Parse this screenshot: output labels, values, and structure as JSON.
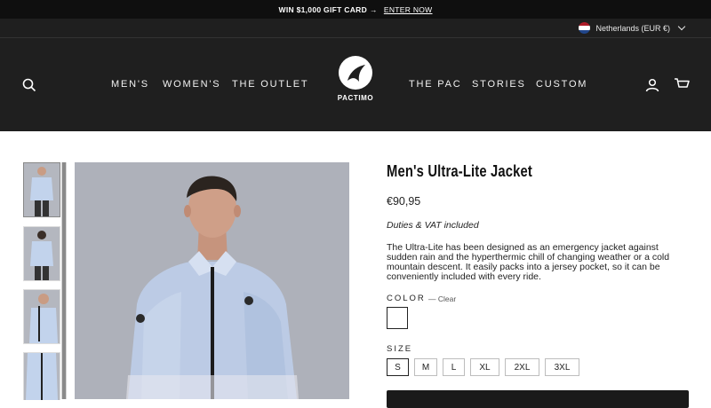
{
  "announcement": {
    "text": "WIN $1,000 GIFT CARD",
    "arrow": "→",
    "link": "ENTER NOW"
  },
  "locale": {
    "label": "Netherlands (EUR €)",
    "flag_colors": [
      "#ae1c28",
      "#ffffff",
      "#21468b"
    ]
  },
  "header": {
    "brand": "PACTIMO",
    "nav_left": [
      "MEN'S",
      "WOMEN'S",
      "THE OUTLET"
    ],
    "nav_right": [
      "THE PAC",
      "STORIES",
      "CUSTOM"
    ],
    "icons": [
      "search-icon",
      "account-icon",
      "cart-icon"
    ]
  },
  "product": {
    "title": "Men's Ultra-Lite Jacket",
    "price": "€90,95",
    "duties": "Duties & VAT included",
    "description": "The Ultra-Lite has been designed as an emergency jacket against sudden rain and the hyperthermic chill of changing weather or a cold mountain descent. It easily packs into a jersey pocket, so it can be conveniently included with every ride.",
    "color_label": "COLOR",
    "color_clear": "— Clear",
    "size_label": "SIZE",
    "sizes": [
      "S",
      "M",
      "L",
      "XL",
      "2XL",
      "3XL"
    ],
    "selected_size": "S"
  },
  "colors": {
    "header_bg": "#1f1f1f",
    "announce_bg": "#0f0f0f",
    "image_bg": "#aeb1ba",
    "jacket": "#b7c9e6"
  }
}
